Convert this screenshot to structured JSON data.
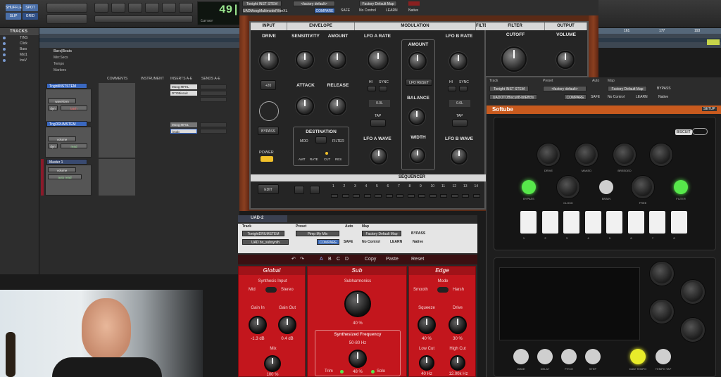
{
  "protools": {
    "modes": [
      "SHUFFLE",
      "SPOT",
      "SLIP",
      "GRID"
    ],
    "counter": {
      "main": "49|2",
      "cursor_label": "Cursor"
    },
    "tracks_header": "TRACKS",
    "track_list": [
      "TINS",
      "Click",
      "Bars",
      "Mst1",
      "InsV"
    ],
    "ruler_marks": [
      "161",
      "177",
      "193"
    ],
    "mixer": {
      "rows": [
        "Bars|Beats",
        "Min:Secs",
        "Tempo",
        "Markers"
      ],
      "columns": [
        "COMMENTS",
        "INSTRUMENT",
        "INSERTS A-E",
        "SENDS A-E"
      ],
      "strips": [
        {
          "name": "TnghtINSTSTEM",
          "view": "waveform",
          "mode": "latch",
          "inserts": [
            "Moog MFKL",
            "DTOBiscuit"
          ]
        },
        {
          "name": "TngDRUMSTEM",
          "view": "volume",
          "mode": "read",
          "inserts": [
            "Moog MF01",
            "bsub"
          ]
        },
        {
          "name": "Master 1",
          "view": "volume",
          "mode": "auto read",
          "inserts": []
        }
      ],
      "dyn_label": "dyn"
    }
  },
  "lfo_plugin": {
    "titlebar": {
      "track": "Tonight INST STEM",
      "preset": "<factory default>",
      "compare": "COMPARE",
      "safe": "SAFE",
      "auto": "Auto",
      "map": "Factory Default Map",
      "no_control": "No Control",
      "learn": "LEARN",
      "native": "Native",
      "insert": "UADMoogMultimodeFilterXL"
    },
    "sections": [
      "INPUT",
      "ENVELOPE",
      "MODULATION",
      "FILTER",
      "OUTPUT"
    ],
    "knobs": {
      "drive": "DRIVE",
      "sensitivity": "SENSITIVITY",
      "amount": "AMOUNT",
      "lfo_a_rate": "LFO A RATE",
      "mod_amount": "AMOUNT",
      "lfo_b_rate": "LFO B RATE",
      "cutoff": "CUTOFF",
      "volume": "VOLUME",
      "attack": "ATTACK",
      "release": "RELEASE",
      "balance": "BALANCE",
      "width": "WIDTH",
      "lfo_a_wave": "LFO A WAVE",
      "lfo_b_wave": "LFO B WAVE"
    },
    "buttons": {
      "plus20": "+20",
      "bypass": "BYPASS",
      "power": "POWER",
      "hi": "HI",
      "sync": "SYNC",
      "lfo_reset": "LFO RESET",
      "tap": "TAP",
      "destination": "DESTINATION",
      "mod": "MOD",
      "filter": "FILTER",
      "edit": "EDIT",
      "byp": "BYP"
    },
    "dest_labels": [
      "AMT",
      "RATE",
      "CUT",
      "RES"
    ],
    "time_values": [
      "0.0L",
      "0.0L"
    ],
    "sequencer": {
      "label": "SEQUENCER",
      "steps": [
        "1",
        "2",
        "3",
        "4",
        "5",
        "6",
        "7",
        "8",
        "9",
        "10",
        "11",
        "12",
        "13",
        "14"
      ]
    }
  },
  "softube_plugin": {
    "titlebar": {
      "track": "Tonight INST STEM",
      "preset": "<factory default>",
      "auto": "Auto",
      "map": "Factory Default Map",
      "bypass": "BYPASS",
      "insert": "UADOTOBiscuit8-bitEffcts",
      "compare": "COMPARE",
      "safe": "SAFE",
      "no_control": "No Control",
      "learn": "LEARN",
      "native": "Native"
    },
    "brand": "Softube",
    "setup": "SETUP",
    "badge": "BISCUIT",
    "knob_labels": [
      "DRIVE",
      "MAKED",
      "BREEDED",
      "",
      "CLOCK",
      "BRAIN",
      "FREE",
      "FILTER"
    ],
    "bypass_label": "BYPASS",
    "pads": [
      "1",
      "2",
      "3",
      "4",
      "5",
      "6",
      "7",
      "8"
    ],
    "bottom_labels": [
      "WAVE",
      "DELAY",
      "PITCH",
      "STEP",
      "DAW TEMPO",
      "TEMPO TAP"
    ]
  },
  "sub_plugin": {
    "tab": "UAD-2",
    "titlebar": {
      "track": "TonightDRUMSTEM",
      "preset": "Pimp My Mix",
      "auto": "Auto",
      "map": "Factory Default Map",
      "bypass": "BYPASS",
      "insert": "UAD bx_subsynth",
      "compare": "COMPARE",
      "safe": "SAFE",
      "no_control": "No Control",
      "learn": "LEARN",
      "native": "Native"
    },
    "toolbar": {
      "a": "A",
      "b": "B",
      "c": "C",
      "d": "D",
      "copy": "Copy",
      "paste": "Paste",
      "reset": "Reset"
    },
    "global": {
      "title": "Global",
      "synth_input": "Synthesis Input",
      "mid": "Mid",
      "stereo": "Stereo",
      "gain_in": "Gain In",
      "gain_out": "Gain Out",
      "gain_in_val": "-1.3 dB",
      "gain_out_val": "0.4 dB",
      "mix": "Mix",
      "mix_val": "100 %"
    },
    "sub": {
      "title": "Sub",
      "subharmonics": "Subharmonics",
      "sub_val": "40 %",
      "synth_freq": "Synthesized Frequency",
      "range": "50-80 Hz",
      "trim": "Trim",
      "solo": "Solo",
      "trim_val": "48 %"
    },
    "edge": {
      "title": "Edge",
      "mode": "Mode",
      "smooth": "Smooth",
      "harsh": "Harsh",
      "squeeze": "Squeeze",
      "drive": "Drive",
      "squeeze_val": "40 %",
      "drive_val": "30 %",
      "low_cut": "Low Cut",
      "high_cut": "High Cut",
      "low_cut_val": "40 Hz",
      "high_cut_val": "12.00k Hz"
    }
  }
}
